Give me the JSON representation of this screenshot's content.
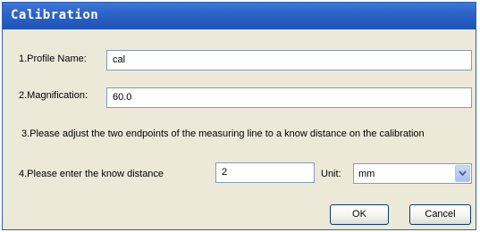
{
  "dialog": {
    "title": "Calibration"
  },
  "profile": {
    "label": "1.Profile Name:",
    "value": "cal"
  },
  "magnification": {
    "label": "2.Magnification:",
    "value": "60.0"
  },
  "instruction": {
    "text": "3.Please adjust the two endpoints of the measuring line to a know distance on the calibration"
  },
  "distance": {
    "label": "4.Please enter the know distance",
    "value": "2"
  },
  "unit": {
    "label": "Unit:",
    "selected": "mm"
  },
  "buttons": {
    "ok": "OK",
    "cancel": "Cancel"
  },
  "icons": {
    "dropdown": "chevron-down-icon"
  }
}
